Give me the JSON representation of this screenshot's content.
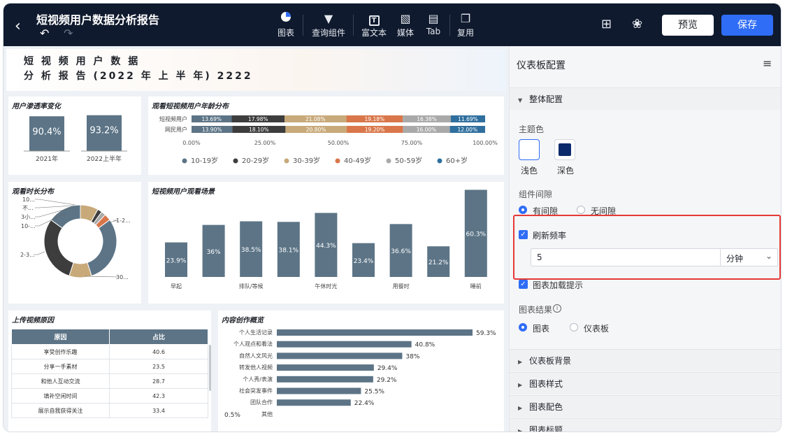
{
  "topbar": {
    "title": "短视频用户数据分析报告",
    "tools": [
      {
        "icon": "pie-chart-icon",
        "label": "图表"
      },
      {
        "icon": "filter-icon",
        "label": "查询组件"
      },
      {
        "icon": "text-icon",
        "label": "富文本"
      },
      {
        "icon": "image-icon",
        "label": "媒体"
      },
      {
        "icon": "tab-icon",
        "label": "Tab"
      },
      {
        "icon": "copy-icon",
        "label": "复用"
      }
    ],
    "preview_label": "预览",
    "save_label": "保存"
  },
  "report": {
    "title_line1": "短 视 频 用 户 数 据",
    "title_line2": "分 析 报 告 (2022 年 上 半 年) 2222"
  },
  "penetration": {
    "title": "用户渗透率变化",
    "bars": [
      {
        "label": "2021年",
        "value": "90.4%",
        "v": 90.4
      },
      {
        "label": "2022上半年",
        "value": "93.2%",
        "v": 93.2
      }
    ]
  },
  "age": {
    "title": "观看短视频用户年龄分布",
    "rows": [
      {
        "label": "短视频用户",
        "values": [
          13.69,
          17.98,
          21.08,
          19.18,
          16.38,
          11.69
        ],
        "texts": [
          "13.69%",
          "17.98%",
          "21.08%",
          "19.18%",
          "16.38%",
          "11.69%"
        ]
      },
      {
        "label": "网民用户",
        "values": [
          13.9,
          18.1,
          20.8,
          19.2,
          16.0,
          12.0
        ],
        "texts": [
          "13.90%",
          "18.10%",
          "20.80%",
          "19.20%",
          "16.00%",
          "12.00%"
        ]
      }
    ],
    "ticks": [
      "0.00%",
      "25.00%",
      "50.00%",
      "75.00%",
      "100.00%"
    ],
    "legend": [
      "10-19岁",
      "20-29岁",
      "30-39岁",
      "40-49岁",
      "50-59岁",
      "60+岁"
    ],
    "colors": [
      "#5c7486",
      "#3d3d3d",
      "#c8a97a",
      "#d9774a",
      "#a9a9a9",
      "#2f6f9e"
    ]
  },
  "duration": {
    "title": "观看时长分布",
    "labels": [
      "10...",
      "不...",
      "3小...",
      "10-...",
      "1-2...",
      "2-3...",
      "30..."
    ],
    "slices": [
      8,
      2,
      2,
      3,
      30,
      10,
      30,
      15
    ],
    "colors": [
      "#c8a97a",
      "#3d3d3d",
      "#a9a9a9",
      "#d9774a",
      "#5c7486",
      "#c8a97a",
      "#3d3d3d",
      "#5c7486"
    ]
  },
  "scene": {
    "title": "短视频用户观看场景",
    "categories": [
      "早起",
      "",
      "排队/等候",
      "",
      "午休时光",
      "",
      "用餐时",
      "",
      "睡前"
    ],
    "values": [
      23.9,
      36,
      38.5,
      38.1,
      44.3,
      23.4,
      36.6,
      21.2,
      60.3
    ],
    "labels": [
      "23.9%",
      "36%",
      "38.5%",
      "38.1%",
      "44.3%",
      "23.4%",
      "36.6%",
      "21.2%",
      "60.3%"
    ]
  },
  "upload": {
    "title": "上传视频原因",
    "headers": [
      "原因",
      "占比"
    ],
    "rows": [
      [
        "享受创作乐趣",
        "40.6"
      ],
      [
        "分享一手素材",
        "23.5"
      ],
      [
        "和他人互动交流",
        "28.7"
      ],
      [
        "填补空闲时间",
        "42.3"
      ],
      [
        "展示自我获得关注",
        "33.4"
      ]
    ]
  },
  "creation": {
    "title": "内容创作概览",
    "items": [
      {
        "label": "个人生活记录",
        "v": 59.3,
        "text": "59.3%"
      },
      {
        "label": "个人观点和看法",
        "v": 40.8,
        "text": "40.8%"
      },
      {
        "label": "自然人文风光",
        "v": 38,
        "text": "38%"
      },
      {
        "label": "转发他人视频",
        "v": 29.4,
        "text": "29.4%"
      },
      {
        "label": "个人秀/表演",
        "v": 29.2,
        "text": "29.2%"
      },
      {
        "label": "社会突发事件",
        "v": 25.5,
        "text": "25.5%"
      },
      {
        "label": "团队合作",
        "v": 22.4,
        "text": "22.4%"
      },
      {
        "label": "其他",
        "v": 0.5,
        "text": "0.5%"
      }
    ]
  },
  "panel": {
    "title": "仪表板配置",
    "section_overall": "整体配置",
    "theme_label": "主题色",
    "theme_light": "浅色",
    "theme_dark": "深色",
    "gap_label": "组件间隙",
    "gap_yes": "有间隙",
    "gap_no": "无间隙",
    "refresh_label": "刷新频率",
    "refresh_value": "5",
    "refresh_unit": "分钟",
    "loading_label": "图表加载提示",
    "result_label": "图表结果",
    "result_chart": "图表",
    "result_dashboard": "仪表板",
    "sections": [
      "仪表板背景",
      "图表样式",
      "图表配色",
      "图表标题"
    ]
  }
}
